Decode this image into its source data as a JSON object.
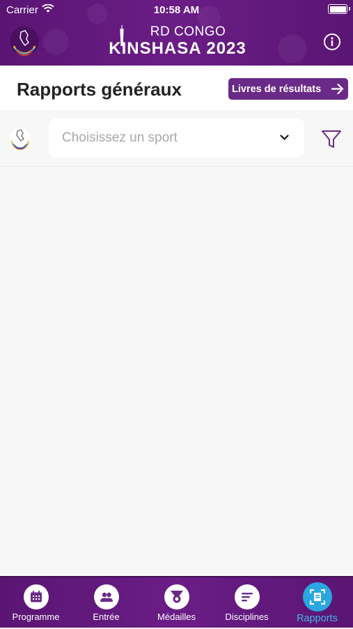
{
  "status_bar": {
    "carrier": "Carrier",
    "time": "10:58 AM"
  },
  "header": {
    "brand_line1": "RD CONGO",
    "brand_line2": "KINSHASA 2023",
    "logo_icon": "games-emblem-icon",
    "info_icon": "info-icon"
  },
  "page": {
    "title": "Rapports généraux",
    "results_button_label": "Livres de résultats"
  },
  "filter": {
    "sport_placeholder": "Choisissez un sport",
    "filter_icon": "funnel-icon"
  },
  "tabs": [
    {
      "label": "Programme",
      "icon": "calendar-icon",
      "active": false
    },
    {
      "label": "Entrée",
      "icon": "people-icon",
      "active": false
    },
    {
      "label": "Médailles",
      "icon": "medal-icon",
      "active": false
    },
    {
      "label": "Disciplines",
      "icon": "list-icon",
      "active": false
    },
    {
      "label": "Rapports",
      "icon": "report-icon",
      "active": true
    }
  ],
  "colors": {
    "brand_purple": "#5e1877",
    "button_purple": "#6a2a87",
    "active_tab_blue": "#2aa6e0"
  }
}
